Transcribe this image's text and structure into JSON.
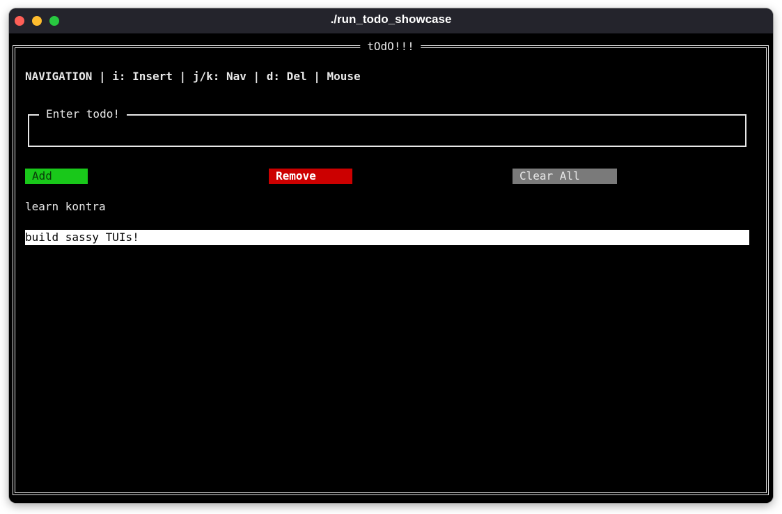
{
  "window": {
    "title": "./run_todo_showcase"
  },
  "app": {
    "frame_title": "tOdO!!!",
    "status_line": "NAVIGATION | i: Insert | j/k: Nav | d: Del | Mouse",
    "input": {
      "legend": "Enter todo!",
      "value": "",
      "placeholder": ""
    },
    "buttons": {
      "add": "Add",
      "remove": "Remove",
      "clear_all": "Clear All"
    },
    "todos": [
      {
        "text": "learn kontra",
        "selected": false
      },
      {
        "text": "build sassy TUIs!",
        "selected": true
      }
    ]
  },
  "colors": {
    "add_button": "#19c81a",
    "remove_button": "#cc0000",
    "clear_button": "#7a7a7a",
    "selection": "#ffffff",
    "terminal_bg": "#000000",
    "titlebar_bg": "#24242c"
  }
}
